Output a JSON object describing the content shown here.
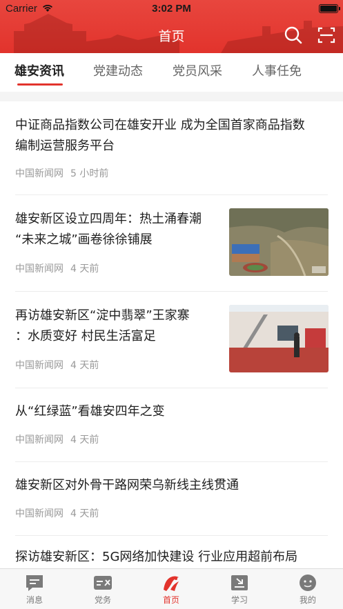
{
  "status_bar": {
    "carrier": "Carrier",
    "time": "3:02 PM"
  },
  "header": {
    "title": "首页"
  },
  "tabs": [
    {
      "label": "雄安资讯",
      "active": true
    },
    {
      "label": "党建动态",
      "active": false
    },
    {
      "label": "党员风采",
      "active": false
    },
    {
      "label": "人事任免",
      "active": false
    }
  ],
  "articles": [
    {
      "title_line1": "中证商品指数公司在雄安开业 成为全国首家商品指数",
      "title_line2": "编制运营服务平台",
      "source": "中国新闻网",
      "age": "5 小时前"
    },
    {
      "title_line1": "雄安新区设立四周年：热土涌春潮",
      "title_line2": "“未来之城”画卷徐徐铺展",
      "source": "中国新闻网",
      "age": "4 天前",
      "thumb": "aerial-photo"
    },
    {
      "title_line1": "再访雄安新区“淀中翡翠”王家寨",
      "title_line2": "：水质变好 村民生活富足",
      "source": "中国新闻网",
      "age": "4 天前",
      "thumb": "village-photo"
    },
    {
      "title_line1": "从“红绿蓝”看雄安四年之变",
      "source": "中国新闻网",
      "age": "4 天前"
    },
    {
      "title_line1": "雄安新区对外骨干路网荣乌新线主线贯通",
      "source": "中国新闻网",
      "age": "4 天前"
    },
    {
      "title_line1": "探访雄安新区：5G网络加快建设 行业应用超前布局"
    }
  ],
  "bottom_nav": [
    {
      "label": "消息",
      "icon": "message-icon",
      "active": false
    },
    {
      "label": "党务",
      "icon": "party-affairs-icon",
      "active": false
    },
    {
      "label": "首页",
      "icon": "xiongan-logo-icon",
      "active": true
    },
    {
      "label": "学习",
      "icon": "study-icon",
      "active": false
    },
    {
      "label": "我的",
      "icon": "profile-icon",
      "active": false
    }
  ],
  "colors": {
    "brand_red": "#e2332c",
    "text": "#1e1e1e",
    "meta": "#999999"
  }
}
